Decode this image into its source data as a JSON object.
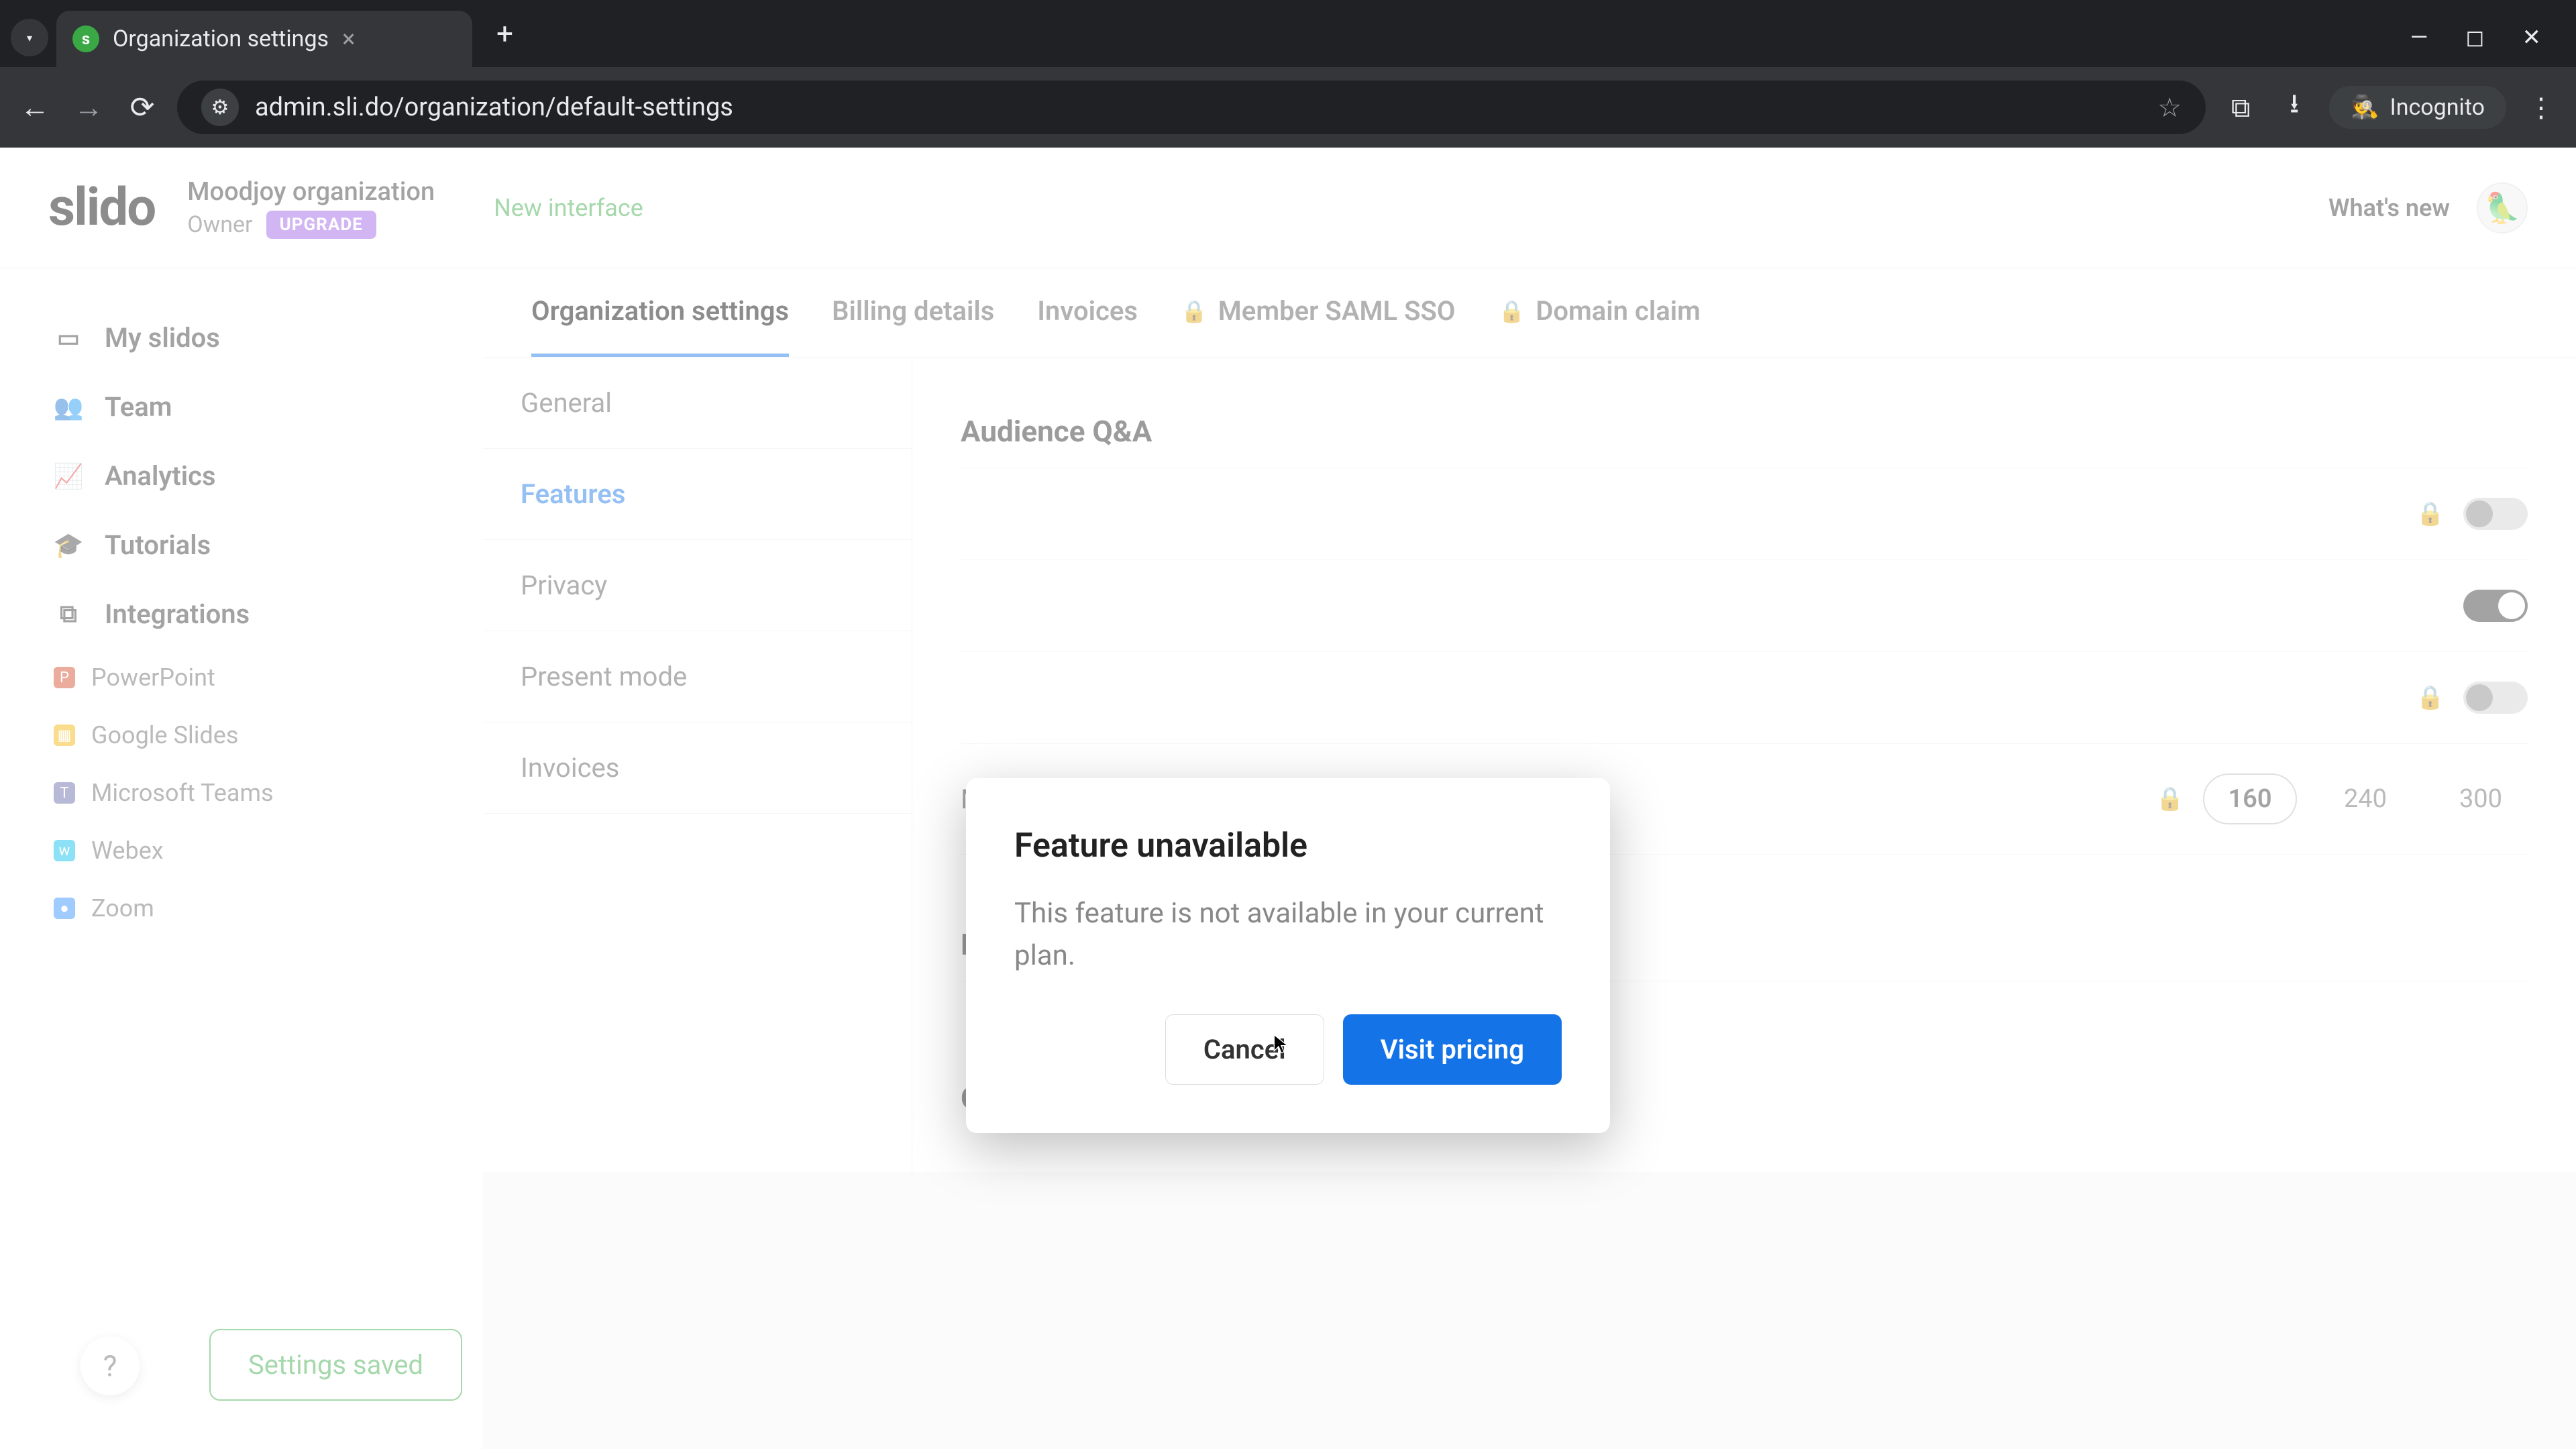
{
  "browser": {
    "tab_title": "Organization settings",
    "url": "admin.sli.do/organization/default-settings",
    "incognito_label": "Incognito"
  },
  "header": {
    "logo": "slido",
    "org_name": "Moodjoy organization",
    "owner_label": "Owner",
    "upgrade_label": "UPGRADE",
    "new_interface": "New interface",
    "whats_new": "What's new"
  },
  "sidebar": {
    "items": [
      {
        "label": "My slidos",
        "icon": "▭"
      },
      {
        "label": "Team",
        "icon": "👥"
      },
      {
        "label": "Analytics",
        "icon": "📈"
      },
      {
        "label": "Tutorials",
        "icon": "🎓"
      },
      {
        "label": "Integrations",
        "icon": "⧉"
      }
    ],
    "integrations": [
      {
        "label": "PowerPoint",
        "cls": "ic-pp",
        "g": "P"
      },
      {
        "label": "Google Slides",
        "cls": "ic-gs",
        "g": "▦"
      },
      {
        "label": "Microsoft Teams",
        "cls": "ic-mt",
        "g": "T"
      },
      {
        "label": "Webex",
        "cls": "ic-wx",
        "g": "w"
      },
      {
        "label": "Zoom",
        "cls": "ic-zm",
        "g": "●"
      }
    ]
  },
  "tabs": [
    {
      "label": "Organization settings",
      "active": true,
      "locked": false
    },
    {
      "label": "Billing details",
      "active": false,
      "locked": false
    },
    {
      "label": "Invoices",
      "active": false,
      "locked": false
    },
    {
      "label": "Member SAML SSO",
      "active": false,
      "locked": true
    },
    {
      "label": "Domain claim",
      "active": false,
      "locked": true
    }
  ],
  "sub_nav": [
    "General",
    "Features",
    "Privacy",
    "Present mode",
    "Invoices"
  ],
  "sub_nav_active": "Features",
  "settings": {
    "section1": "Audience Q&A",
    "rows": [
      {
        "label": "",
        "locked": true,
        "toggle": false
      },
      {
        "label": "",
        "locked": false,
        "toggle": true
      },
      {
        "label": "",
        "locked": true,
        "toggle": false
      }
    ],
    "length_label": "Max. question length",
    "length_options": [
      "160",
      "240",
      "300"
    ],
    "length_active": "160",
    "section2": "Polls",
    "section3": "Open text"
  },
  "modal": {
    "title": "Feature unavailable",
    "body": "This feature is not available in your current plan.",
    "cancel": "Cancel",
    "confirm": "Visit pricing"
  },
  "toast": "Settings saved"
}
